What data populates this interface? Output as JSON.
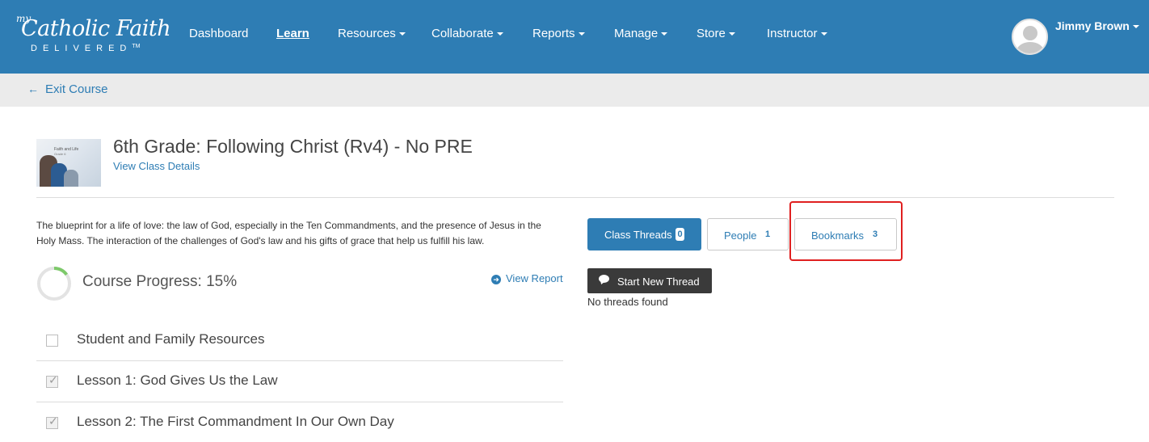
{
  "brand": {
    "logo_my": "my",
    "logo_script": "Catholic Faith",
    "logo_delivered": "DELIVERED",
    "logo_tm": "TM"
  },
  "nav": {
    "items": [
      {
        "label": "Dashboard",
        "dropdown": false,
        "active": false
      },
      {
        "label": "Learn",
        "dropdown": false,
        "active": true
      },
      {
        "label": "Resources",
        "dropdown": true,
        "active": false
      },
      {
        "label": "Collaborate",
        "dropdown": true,
        "active": false
      },
      {
        "label": "Reports",
        "dropdown": true,
        "active": false
      },
      {
        "label": "Manage",
        "dropdown": true,
        "active": false
      },
      {
        "label": "Store",
        "dropdown": true,
        "active": false
      },
      {
        "label": "Instructor",
        "dropdown": true,
        "active": false
      }
    ],
    "user_name": "Jimmy Brown"
  },
  "subbar": {
    "exit_label": "Exit Course"
  },
  "course": {
    "thumb_title": "Faith and Life",
    "thumb_subtitle": "Grade 6",
    "title": "6th Grade: Following Christ (Rv4) - No PRE",
    "details_link": "View Class Details",
    "description": "The blueprint for a life of love: the law of God, especially in the Ten Commandments, and the presence of Jesus in the Holy Mass. The interaction of the challenges of God's law and his gifts of grace that help us fulfill his law.",
    "progress_label": "Course Progress: 15%",
    "progress_fraction": 0.15,
    "view_report": "View Report"
  },
  "lessons": [
    {
      "label": "Student and Family Resources",
      "completed": false
    },
    {
      "label": "Lesson 1: God Gives Us the Law",
      "completed": true
    },
    {
      "label": "Lesson 2: The First Commandment In Our Own Day",
      "completed": true
    }
  ],
  "discussion": {
    "threads_label": "Class Threads",
    "threads_count": "0",
    "people_label": "People",
    "people_count": "1",
    "bookmarks_label": "Bookmarks",
    "bookmarks_count": "3",
    "start_thread_label": "Start New Thread",
    "empty_message": "No threads found"
  },
  "colors": {
    "brand_blue": "#2e7db4",
    "progress_green": "#7dc96a",
    "highlight_red": "#e02020"
  }
}
